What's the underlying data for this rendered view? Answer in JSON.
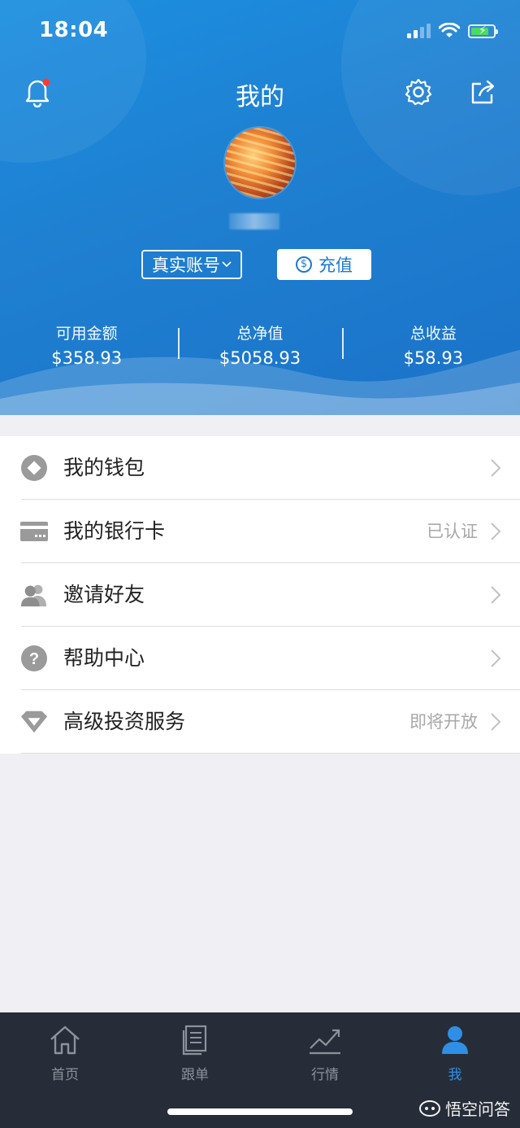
{
  "status_bar": {
    "time": "18:04"
  },
  "header": {
    "title": "我的"
  },
  "account": {
    "type_label": "真实账号",
    "recharge_label": "充值"
  },
  "stats": [
    {
      "label": "可用金额",
      "value": "$358.93"
    },
    {
      "label": "总净值",
      "value": "$5058.93"
    },
    {
      "label": "总收益",
      "value": "$58.93"
    }
  ],
  "menu": [
    {
      "label": "我的钱包",
      "right": ""
    },
    {
      "label": "我的银行卡",
      "right": "已认证"
    },
    {
      "label": "邀请好友",
      "right": ""
    },
    {
      "label": "帮助中心",
      "right": ""
    },
    {
      "label": "高级投资服务",
      "right": "即将开放"
    }
  ],
  "tabbar": [
    {
      "label": "首页"
    },
    {
      "label": "跟单"
    },
    {
      "label": "行情"
    },
    {
      "label": "我"
    }
  ],
  "watermark": "悟空问答",
  "colors": {
    "primary": "#1f80d2",
    "active_tab": "#2f8fe6",
    "tabbar_bg": "#262d38",
    "notification_dot": "#ff3b30"
  }
}
